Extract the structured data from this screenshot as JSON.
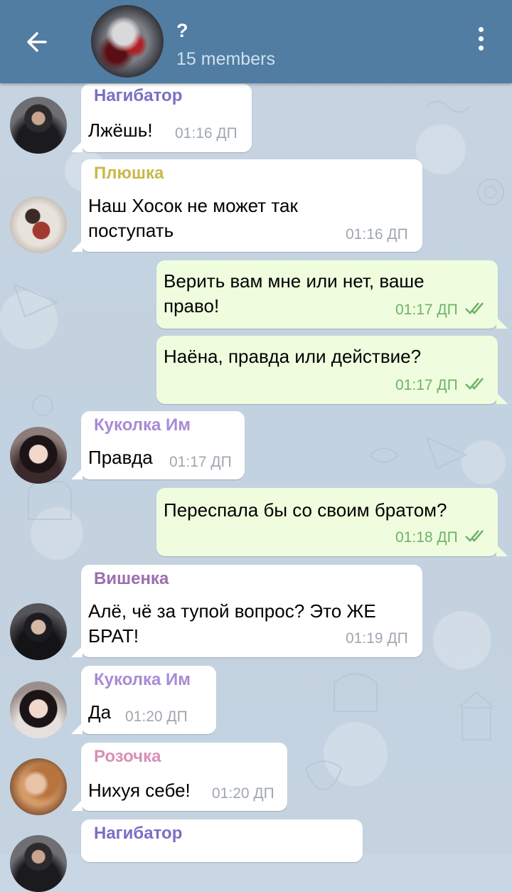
{
  "header": {
    "title": "?",
    "subtitle": "15 members"
  },
  "messages": [
    {
      "sender": "Нагибатор",
      "text": "Лжёшь!",
      "time": "01:16 ДП"
    },
    {
      "sender": "Плюшка",
      "text": "Наш Хосок не может так поступать",
      "time": "01:16 ДП"
    },
    {
      "text": "Верить вам мне или нет, ваше право!",
      "time": "01:17 ДП"
    },
    {
      "text": "Наёна, правда или действие?",
      "time": "01:17 ДП"
    },
    {
      "sender": "Куколка Им",
      "text": "Правда",
      "time": "01:17 ДП"
    },
    {
      "text": "Переспала бы со своим братом?",
      "time": "01:18 ДП"
    },
    {
      "sender": "Вишенка",
      "text": "Алё, чё за тупой вопрос? Это ЖЕ БРАТ!",
      "time": "01:19 ДП"
    },
    {
      "sender": "Куколка Им",
      "text": "Да",
      "time": "01:20 ДП"
    },
    {
      "sender": "Розочка",
      "text": "Нихуя себе!",
      "time": "01:20 ДП"
    },
    {
      "sender": "Нагибатор"
    }
  ],
  "colors": {
    "header_bg": "#517da2",
    "sender_nagibator": "#7b6fc4",
    "sender_plyushka": "#c9b84a",
    "sender_kukolka": "#a78bd6",
    "sender_vishenka": "#9b6fae",
    "sender_rozochka": "#d88fb6",
    "outgoing_bubble": "#effdde",
    "read_ticks": "#6fb26a"
  },
  "icons": {
    "back": "arrow-left-icon",
    "menu": "more-vertical-icon",
    "read": "double-check-icon"
  }
}
